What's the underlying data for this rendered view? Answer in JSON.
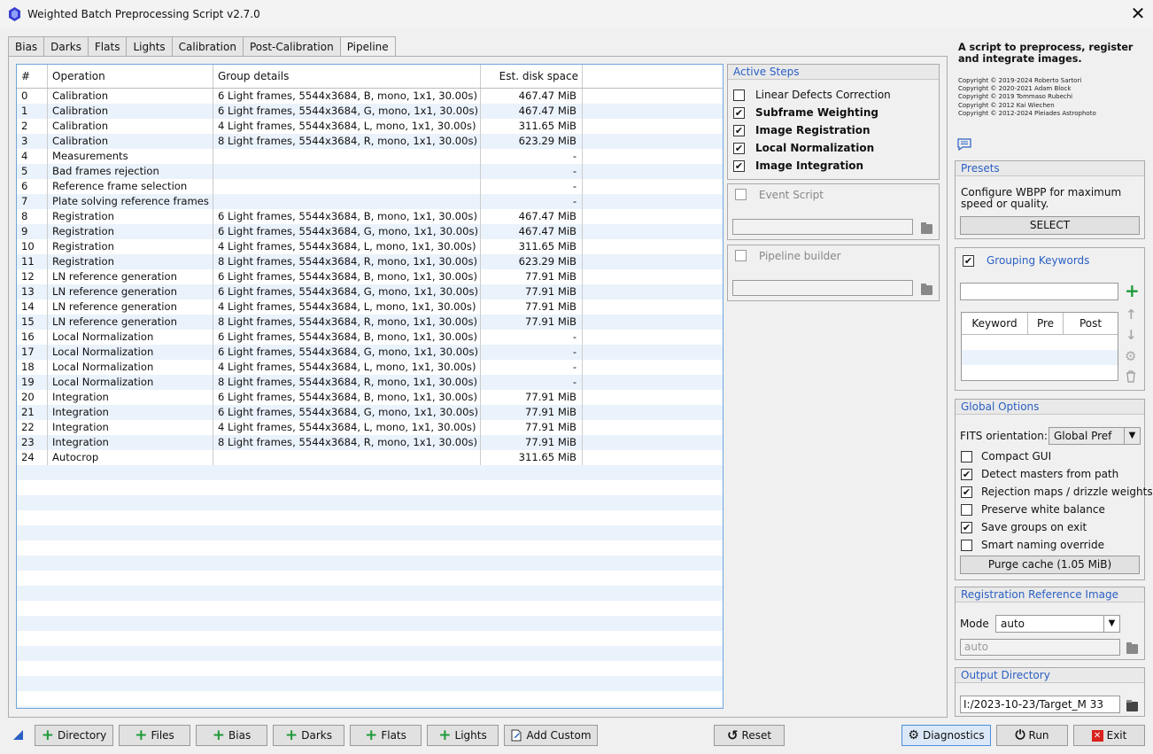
{
  "window": {
    "title": "Weighted Batch Preprocessing Script v2.7.0"
  },
  "tabs": [
    "Bias",
    "Darks",
    "Flats",
    "Lights",
    "Calibration",
    "Post-Calibration",
    "Pipeline"
  ],
  "active_tab": "Pipeline",
  "table": {
    "headers": [
      "#",
      "Operation",
      "Group details",
      "Est. disk space"
    ],
    "rows": [
      [
        "0",
        "Calibration",
        "6 Light frames, 5544x3684, B, mono, 1x1, 30.00s)",
        "467.47 MiB"
      ],
      [
        "1",
        "Calibration",
        "6 Light frames, 5544x3684, G, mono, 1x1, 30.00s)",
        "467.47 MiB"
      ],
      [
        "2",
        "Calibration",
        "4 Light frames, 5544x3684, L, mono, 1x1, 30.00s)",
        "311.65 MiB"
      ],
      [
        "3",
        "Calibration",
        "8 Light frames, 5544x3684, R, mono, 1x1, 30.00s)",
        "623.29 MiB"
      ],
      [
        "4",
        "Measurements",
        "",
        "-"
      ],
      [
        "5",
        "Bad frames rejection",
        "",
        "-"
      ],
      [
        "6",
        "Reference frame selection",
        "",
        "-"
      ],
      [
        "7",
        "Plate solving reference frames",
        "",
        "-"
      ],
      [
        "8",
        "Registration",
        "6 Light frames, 5544x3684, B, mono, 1x1, 30.00s)",
        "467.47 MiB"
      ],
      [
        "9",
        "Registration",
        "6 Light frames, 5544x3684, G, mono, 1x1, 30.00s)",
        "467.47 MiB"
      ],
      [
        "10",
        "Registration",
        "4 Light frames, 5544x3684, L, mono, 1x1, 30.00s)",
        "311.65 MiB"
      ],
      [
        "11",
        "Registration",
        "8 Light frames, 5544x3684, R, mono, 1x1, 30.00s)",
        "623.29 MiB"
      ],
      [
        "12",
        "LN reference generation",
        "6 Light frames, 5544x3684, B, mono, 1x1, 30.00s)",
        "77.91 MiB"
      ],
      [
        "13",
        "LN reference generation",
        "6 Light frames, 5544x3684, G, mono, 1x1, 30.00s)",
        "77.91 MiB"
      ],
      [
        "14",
        "LN reference generation",
        "4 Light frames, 5544x3684, L, mono, 1x1, 30.00s)",
        "77.91 MiB"
      ],
      [
        "15",
        "LN reference generation",
        "8 Light frames, 5544x3684, R, mono, 1x1, 30.00s)",
        "77.91 MiB"
      ],
      [
        "16",
        "Local Normalization",
        "6 Light frames, 5544x3684, B, mono, 1x1, 30.00s)",
        "-"
      ],
      [
        "17",
        "Local Normalization",
        "6 Light frames, 5544x3684, G, mono, 1x1, 30.00s)",
        "-"
      ],
      [
        "18",
        "Local Normalization",
        "4 Light frames, 5544x3684, L, mono, 1x1, 30.00s)",
        "-"
      ],
      [
        "19",
        "Local Normalization",
        "8 Light frames, 5544x3684, R, mono, 1x1, 30.00s)",
        "-"
      ],
      [
        "20",
        "Integration",
        "6 Light frames, 5544x3684, B, mono, 1x1, 30.00s)",
        "77.91 MiB"
      ],
      [
        "21",
        "Integration",
        "6 Light frames, 5544x3684, G, mono, 1x1, 30.00s)",
        "77.91 MiB"
      ],
      [
        "22",
        "Integration",
        "4 Light frames, 5544x3684, L, mono, 1x1, 30.00s)",
        "77.91 MiB"
      ],
      [
        "23",
        "Integration",
        "8 Light frames, 5544x3684, R, mono, 1x1, 30.00s)",
        "77.91 MiB"
      ],
      [
        "24",
        "Autocrop",
        "",
        "311.65 MiB"
      ]
    ]
  },
  "active_steps": {
    "title": "Active Steps",
    "items": [
      {
        "label": "Linear Defects Correction",
        "checked": false
      },
      {
        "label": "Subframe Weighting",
        "checked": true
      },
      {
        "label": "Image Registration",
        "checked": true
      },
      {
        "label": "Local Normalization",
        "checked": true
      },
      {
        "label": "Image Integration",
        "checked": true
      }
    ]
  },
  "event_script": {
    "label": "Event Script"
  },
  "pipeline_builder": {
    "label": "Pipeline builder"
  },
  "description": "A script to preprocess, register and integrate images.",
  "copyright": [
    "Copyright © 2019-2024 Roberto Sartori",
    "Copyright © 2020-2021 Adam Block",
    "Copyright © 2019 Tommaso Rubechi",
    "Copyright © 2012 Kai Wiechen",
    "Copyright © 2012-2024 Pleiades Astrophoto"
  ],
  "presets": {
    "title": "Presets",
    "text": "Configure WBPP for maximum speed or quality.",
    "button": "SELECT"
  },
  "grouping": {
    "title": "Grouping Keywords",
    "checked": true,
    "headers": [
      "Keyword",
      "Pre",
      "Post"
    ]
  },
  "global_options": {
    "title": "Global Options",
    "fits_label": "FITS orientation:",
    "fits_value": "Global Pref",
    "options": [
      {
        "label": "Compact GUI",
        "checked": false
      },
      {
        "label": "Detect masters from path",
        "checked": true
      },
      {
        "label": "Rejection maps / drizzle weights",
        "checked": true
      },
      {
        "label": "Preserve white balance",
        "checked": false
      },
      {
        "label": "Save groups on exit",
        "checked": true
      },
      {
        "label": "Smart naming override",
        "checked": false
      }
    ],
    "purge": "Purge cache (1.05 MiB)"
  },
  "registration_ref": {
    "title": "Registration Reference Image",
    "mode_label": "Mode",
    "mode_value": "auto",
    "path": "auto"
  },
  "output_dir": {
    "title": "Output Directory",
    "value": "I:/2023-10-23/Target_M 33"
  },
  "bottom": {
    "directory": "Directory",
    "files": "Files",
    "bias": "Bias",
    "darks": "Darks",
    "flats": "Flats",
    "lights": "Lights",
    "add_custom": "Add Custom",
    "reset": "Reset",
    "diagnostics": "Diagnostics",
    "run": "Run",
    "exit": "Exit"
  },
  "colors": {
    "accent": "#2a5fc4",
    "plus": "#1f9a3a",
    "exit": "#d9221c",
    "row_alt": "#eaf2fb"
  }
}
